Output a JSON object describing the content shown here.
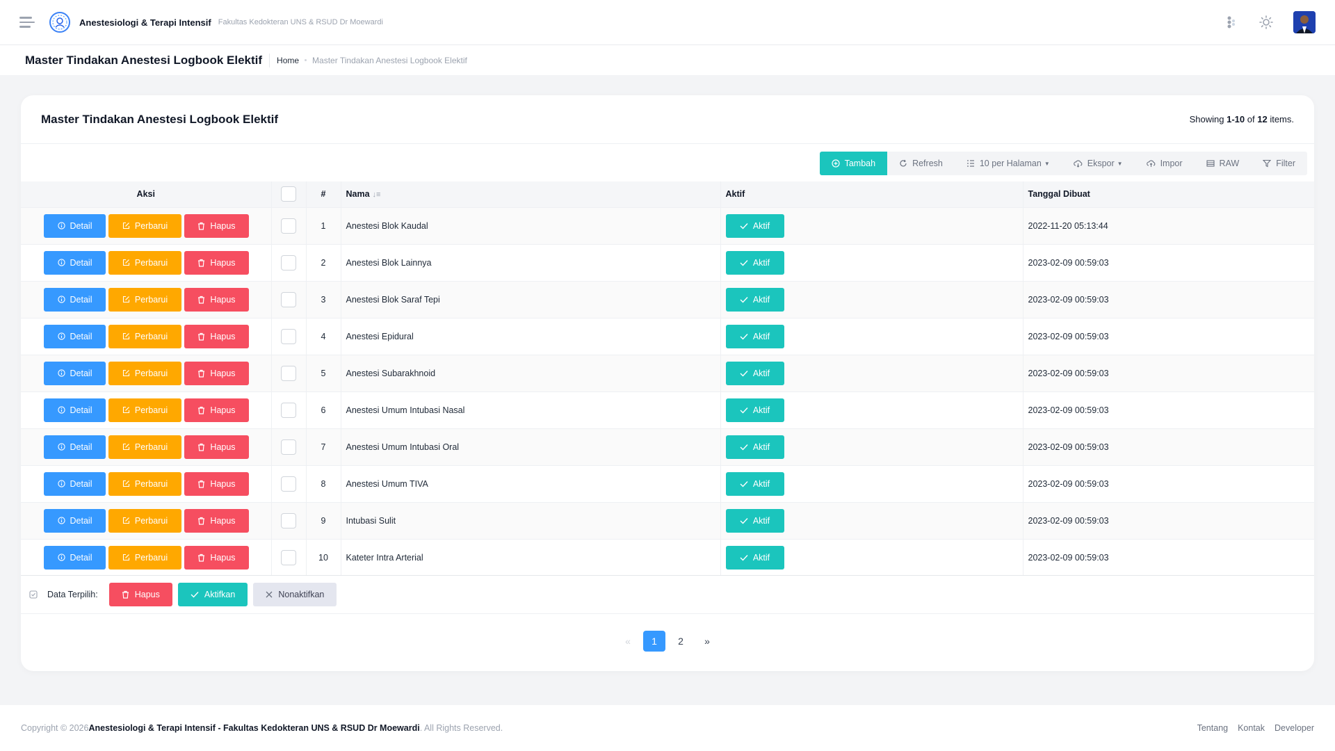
{
  "header": {
    "brand_title": "Anestesiologi & Terapi Intensif",
    "brand_subtitle": "Fakultas Kedokteran UNS & RSUD Dr Moewardi"
  },
  "subheader": {
    "page_title": "Master Tindakan Anestesi Logbook Elektif",
    "breadcrumb_home": "Home",
    "breadcrumb_current": "Master Tindakan Anestesi Logbook Elektif"
  },
  "card": {
    "title": "Master Tindakan Anestesi Logbook Elektif",
    "summary_prefix": "Showing ",
    "summary_range": "1-10",
    "summary_of": " of ",
    "summary_total": "12",
    "summary_suffix": " items."
  },
  "toolbar": {
    "tambah": "Tambah",
    "refresh": "Refresh",
    "per_page": "10 per Halaman",
    "ekspor": "Ekspor",
    "impor": "Impor",
    "raw": "RAW",
    "filter": "Filter"
  },
  "table": {
    "headers": {
      "aksi": "Aksi",
      "no": "#",
      "nama": "Nama",
      "aktif": "Aktif",
      "tanggal": "Tanggal Dibuat"
    },
    "action_labels": {
      "detail": "Detail",
      "perbarui": "Perbarui",
      "hapus": "Hapus",
      "aktif": "Aktif"
    },
    "rows": [
      {
        "no": "1",
        "nama": "Anestesi Blok Kaudal",
        "tanggal": "2022-11-20 05:13:44"
      },
      {
        "no": "2",
        "nama": "Anestesi Blok Lainnya",
        "tanggal": "2023-02-09 00:59:03"
      },
      {
        "no": "3",
        "nama": "Anestesi Blok Saraf Tepi",
        "tanggal": "2023-02-09 00:59:03"
      },
      {
        "no": "4",
        "nama": "Anestesi Epidural",
        "tanggal": "2023-02-09 00:59:03"
      },
      {
        "no": "5",
        "nama": "Anestesi Subarakhnoid",
        "tanggal": "2023-02-09 00:59:03"
      },
      {
        "no": "6",
        "nama": "Anestesi Umum Intubasi Nasal",
        "tanggal": "2023-02-09 00:59:03"
      },
      {
        "no": "7",
        "nama": "Anestesi Umum Intubasi Oral",
        "tanggal": "2023-02-09 00:59:03"
      },
      {
        "no": "8",
        "nama": "Anestesi Umum TIVA",
        "tanggal": "2023-02-09 00:59:03"
      },
      {
        "no": "9",
        "nama": "Intubasi Sulit",
        "tanggal": "2023-02-09 00:59:03"
      },
      {
        "no": "10",
        "nama": "Kateter Intra Arterial",
        "tanggal": "2023-02-09 00:59:03"
      }
    ]
  },
  "bulk": {
    "label": "Data Terpilih:",
    "hapus": "Hapus",
    "aktifkan": "Aktifkan",
    "nonaktifkan": "Nonaktifkan"
  },
  "pagination": {
    "prev": "«",
    "pages": [
      "1",
      "2"
    ],
    "active": "1",
    "next": "»"
  },
  "footer": {
    "copyright": "Copyright © 2026 ",
    "org": "Anestesiologi & Terapi Intensif - Fakultas Kedokteran UNS & RSUD Dr Moewardi",
    "rights": ". All Rights Reserved.",
    "links": [
      "Tentang",
      "Kontak",
      "Developer"
    ]
  },
  "colors": {
    "primary_teal": "#1bc5bd",
    "info_blue": "#3699ff",
    "warning_orange": "#ffa800",
    "danger_red": "#f64e60"
  }
}
